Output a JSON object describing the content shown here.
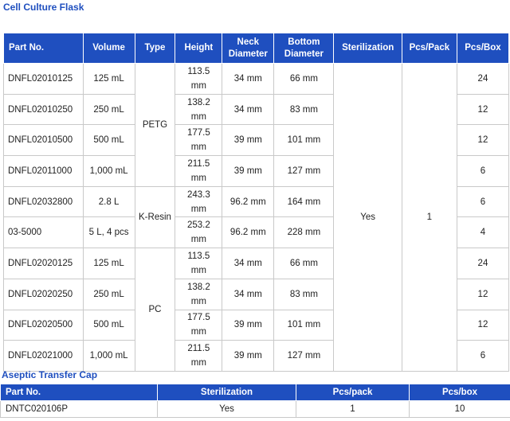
{
  "flask": {
    "title": "Cell Culture Flask",
    "headers": {
      "part_no": "Part No.",
      "volume": "Volume",
      "type": "Type",
      "height": "Height",
      "neck_1": "Neck",
      "neck_2": "Diameter",
      "bottom_1": "Bottom",
      "bottom_2": "Diameter",
      "sterilization": "Sterilization",
      "pcs_pack": "Pcs/Pack",
      "pcs_box": "Pcs/Box"
    },
    "types": {
      "petg": "PETG",
      "kresin": "K-Resin",
      "pc": "PC"
    },
    "sterilization": "Yes",
    "pcs_pack": "1",
    "rows": [
      {
        "part": "DNFL02010125",
        "volume": "125 mL",
        "height_1": "113.5",
        "height_2": "mm",
        "neck": "34 mm",
        "bottom": "66 mm",
        "box": "24"
      },
      {
        "part": "DNFL02010250",
        "volume": "250 mL",
        "height_1": "138.2",
        "height_2": "mm",
        "neck": "34 mm",
        "bottom": "83 mm",
        "box": "12"
      },
      {
        "part": "DNFL02010500",
        "volume": "500 mL",
        "height_1": "177.5",
        "height_2": "mm",
        "neck": "39 mm",
        "bottom": "101 mm",
        "box": "12"
      },
      {
        "part": "DNFL02011000",
        "volume": "1,000 mL",
        "height_1": "211.5",
        "height_2": "mm",
        "neck": "39 mm",
        "bottom": "127 mm",
        "box": "6"
      },
      {
        "part": "DNFL02032800",
        "volume": "2.8 L",
        "height_1": "243.3",
        "height_2": "mm",
        "neck": "96.2 mm",
        "bottom": "164 mm",
        "box": "6"
      },
      {
        "part": "03-5000",
        "volume": "5 L, 4 pcs",
        "height_1": "253.2",
        "height_2": "mm",
        "neck": "96.2 mm",
        "bottom": "228 mm",
        "box": "4"
      },
      {
        "part": "DNFL02020125",
        "volume": "125 mL",
        "height_1": "113.5",
        "height_2": "mm",
        "neck": "34 mm",
        "bottom": "66 mm",
        "box": "24"
      },
      {
        "part": "DNFL02020250",
        "volume": "250 mL",
        "height_1": "138.2",
        "height_2": "mm",
        "neck": "34 mm",
        "bottom": "83 mm",
        "box": "12"
      },
      {
        "part": "DNFL02020500",
        "volume": "500 mL",
        "height_1": "177.5",
        "height_2": "mm",
        "neck": "39 mm",
        "bottom": "101 mm",
        "box": "12"
      },
      {
        "part": "DNFL02021000",
        "volume": "1,000 mL",
        "height_1": "211.5",
        "height_2": "mm",
        "neck": "39 mm",
        "bottom": "127 mm",
        "box": "6"
      }
    ]
  },
  "cap": {
    "title": "Aseptic Transfer Cap",
    "headers": {
      "part_no": "Part No.",
      "sterilization": "Sterilization",
      "pcs_pack": "Pcs/pack",
      "pcs_box": "Pcs/box"
    },
    "row": {
      "part": "DNTC020106P",
      "sterilization": "Yes",
      "pack": "1",
      "box": "10"
    }
  },
  "colors": {
    "header_bg": "#1f4fbf",
    "title": "#1f4fbf"
  }
}
